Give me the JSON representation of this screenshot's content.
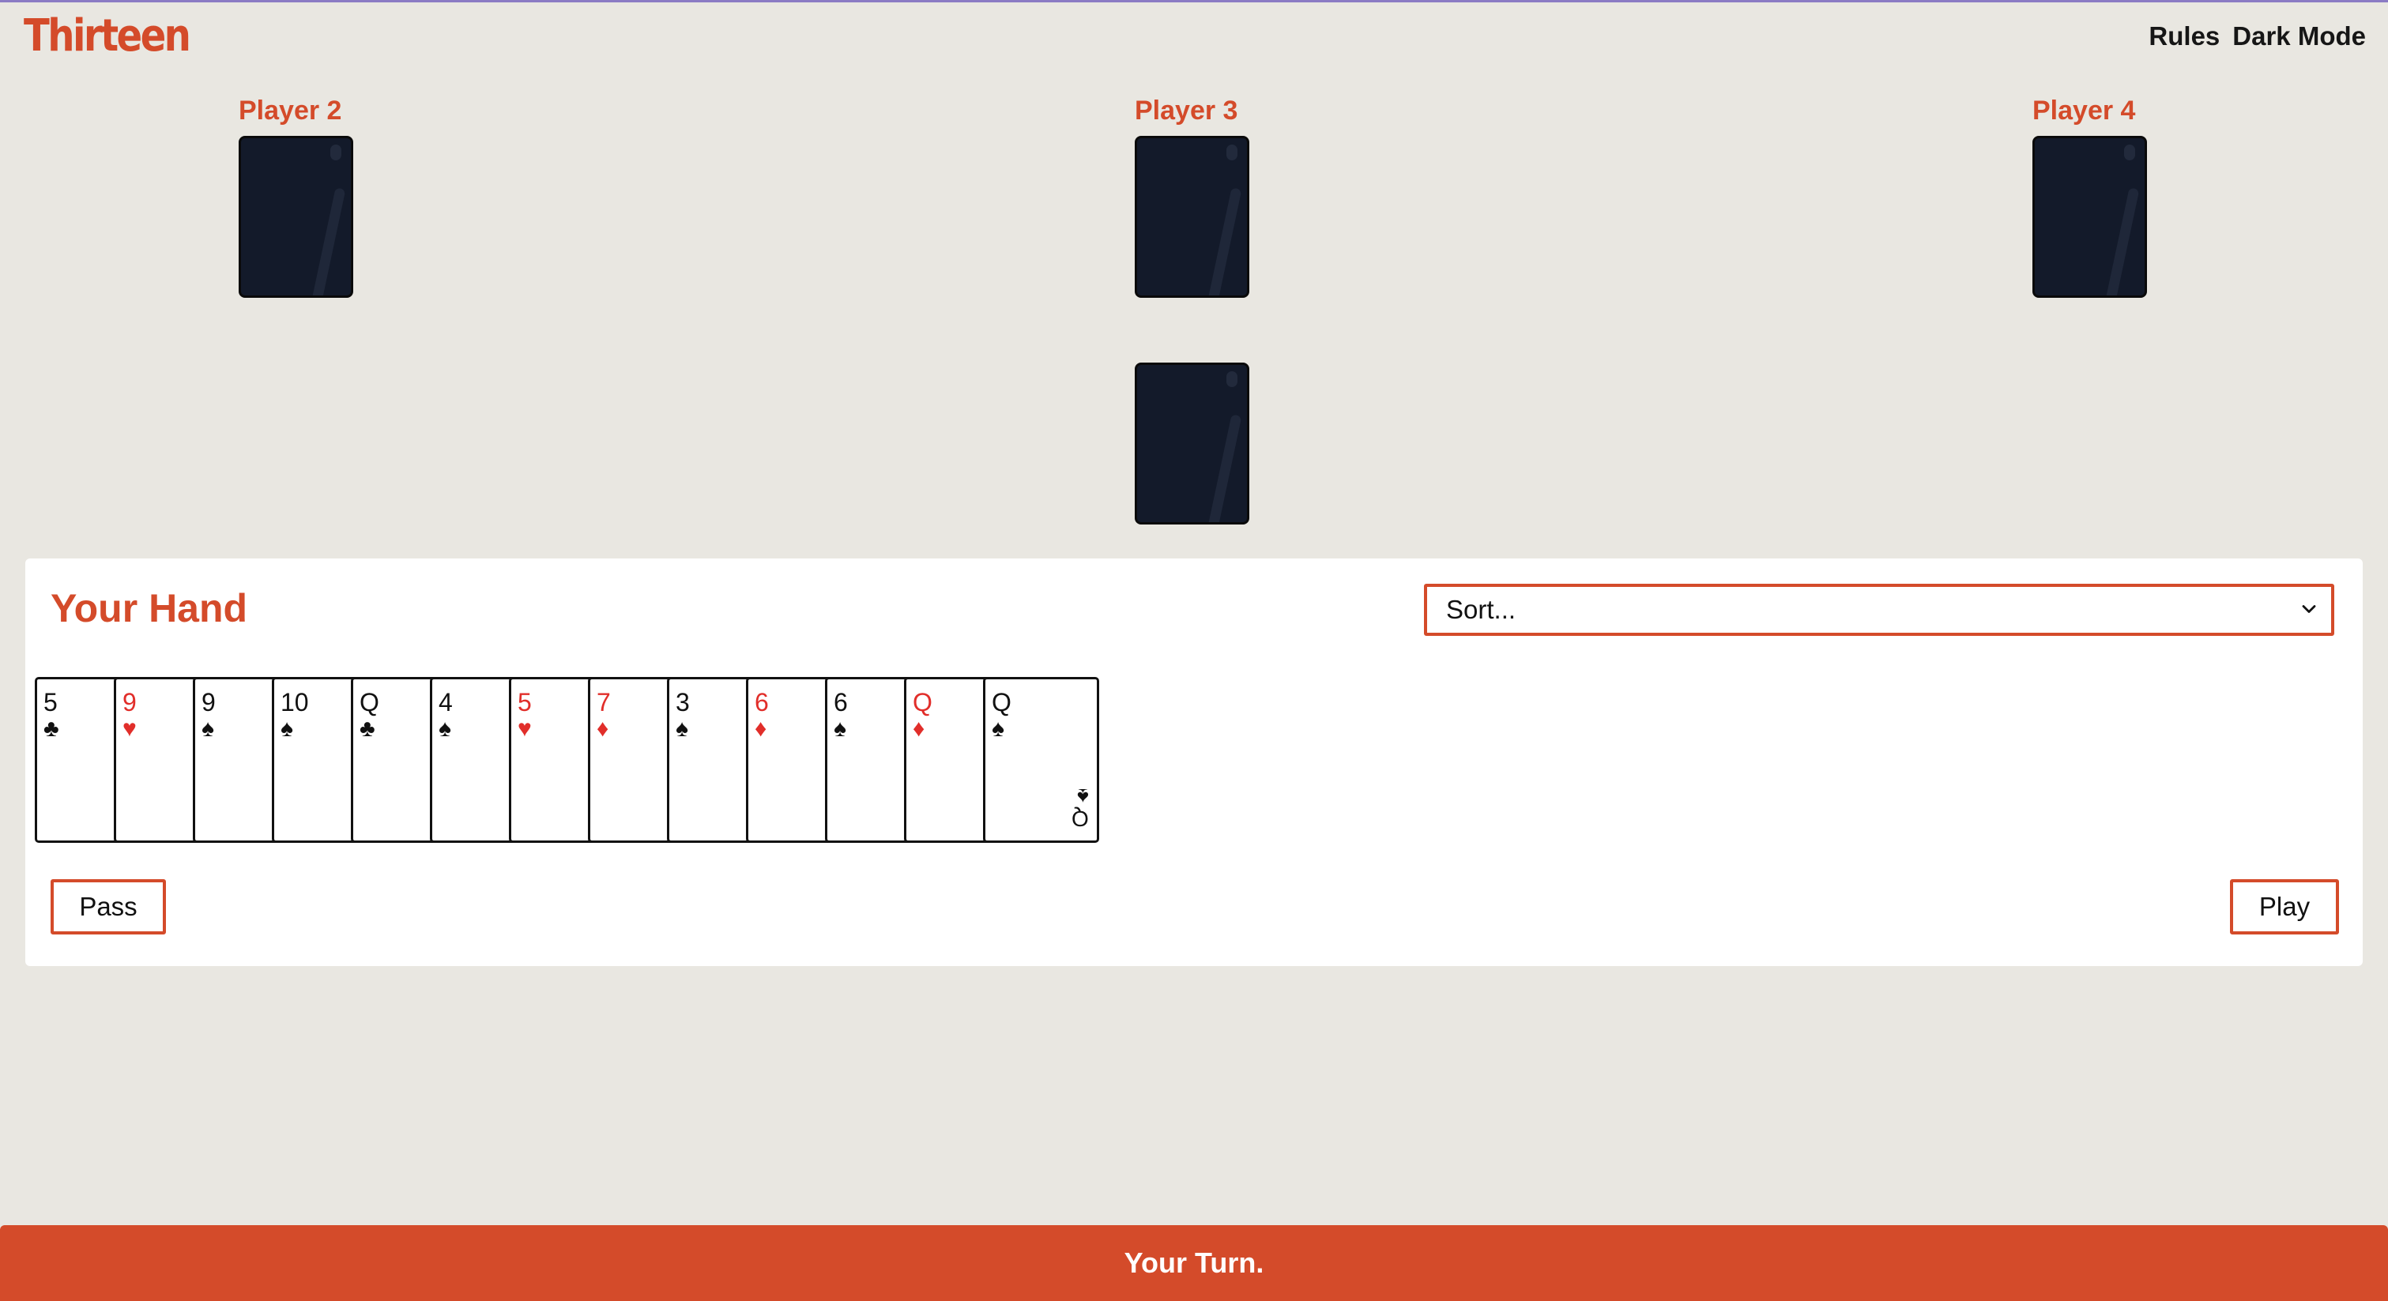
{
  "app": {
    "logo": "Thirteen"
  },
  "nav": {
    "rules": "Rules",
    "dark_mode": "Dark Mode"
  },
  "opponents": [
    {
      "name": "Player 2"
    },
    {
      "name": "Player 3"
    },
    {
      "name": "Player 4"
    }
  ],
  "hand": {
    "title": "Your Hand",
    "sort_placeholder": "Sort...",
    "cards": [
      {
        "rank": "5",
        "suit": "♣",
        "color": "black"
      },
      {
        "rank": "9",
        "suit": "♥",
        "color": "red"
      },
      {
        "rank": "9",
        "suit": "♠",
        "color": "black"
      },
      {
        "rank": "10",
        "suit": "♠",
        "color": "black"
      },
      {
        "rank": "Q",
        "suit": "♣",
        "color": "black"
      },
      {
        "rank": "4",
        "suit": "♠",
        "color": "black"
      },
      {
        "rank": "5",
        "suit": "♥",
        "color": "red"
      },
      {
        "rank": "7",
        "suit": "♦",
        "color": "red"
      },
      {
        "rank": "3",
        "suit": "♠",
        "color": "black"
      },
      {
        "rank": "6",
        "suit": "♦",
        "color": "red"
      },
      {
        "rank": "6",
        "suit": "♠",
        "color": "black"
      },
      {
        "rank": "Q",
        "suit": "♦",
        "color": "red"
      },
      {
        "rank": "Q",
        "suit": "♠",
        "color": "black"
      }
    ]
  },
  "actions": {
    "pass": "Pass",
    "play": "Play"
  },
  "status": {
    "message": "Your Turn."
  },
  "colors": {
    "accent": "#d44b2a",
    "background": "#e9e7e1",
    "card_back": "#131a2a",
    "red_suit": "#e12e2a"
  }
}
